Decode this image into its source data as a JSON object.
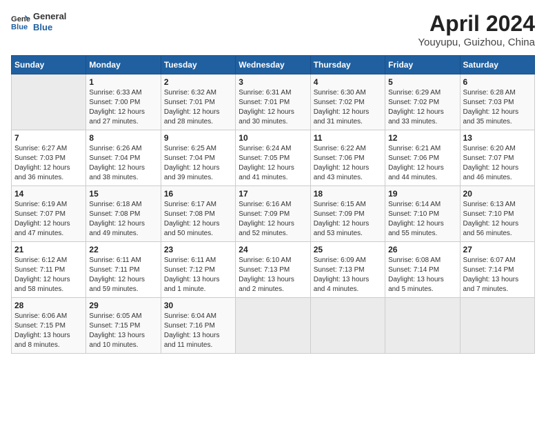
{
  "header": {
    "logo_line1": "General",
    "logo_line2": "Blue",
    "title": "April 2024",
    "subtitle": "Youyupu, Guizhou, China"
  },
  "days_of_week": [
    "Sunday",
    "Monday",
    "Tuesday",
    "Wednesday",
    "Thursday",
    "Friday",
    "Saturday"
  ],
  "weeks": [
    [
      {
        "day": "",
        "info": ""
      },
      {
        "day": "1",
        "info": "Sunrise: 6:33 AM\nSunset: 7:00 PM\nDaylight: 12 hours\nand 27 minutes."
      },
      {
        "day": "2",
        "info": "Sunrise: 6:32 AM\nSunset: 7:01 PM\nDaylight: 12 hours\nand 28 minutes."
      },
      {
        "day": "3",
        "info": "Sunrise: 6:31 AM\nSunset: 7:01 PM\nDaylight: 12 hours\nand 30 minutes."
      },
      {
        "day": "4",
        "info": "Sunrise: 6:30 AM\nSunset: 7:02 PM\nDaylight: 12 hours\nand 31 minutes."
      },
      {
        "day": "5",
        "info": "Sunrise: 6:29 AM\nSunset: 7:02 PM\nDaylight: 12 hours\nand 33 minutes."
      },
      {
        "day": "6",
        "info": "Sunrise: 6:28 AM\nSunset: 7:03 PM\nDaylight: 12 hours\nand 35 minutes."
      }
    ],
    [
      {
        "day": "7",
        "info": "Sunrise: 6:27 AM\nSunset: 7:03 PM\nDaylight: 12 hours\nand 36 minutes."
      },
      {
        "day": "8",
        "info": "Sunrise: 6:26 AM\nSunset: 7:04 PM\nDaylight: 12 hours\nand 38 minutes."
      },
      {
        "day": "9",
        "info": "Sunrise: 6:25 AM\nSunset: 7:04 PM\nDaylight: 12 hours\nand 39 minutes."
      },
      {
        "day": "10",
        "info": "Sunrise: 6:24 AM\nSunset: 7:05 PM\nDaylight: 12 hours\nand 41 minutes."
      },
      {
        "day": "11",
        "info": "Sunrise: 6:22 AM\nSunset: 7:06 PM\nDaylight: 12 hours\nand 43 minutes."
      },
      {
        "day": "12",
        "info": "Sunrise: 6:21 AM\nSunset: 7:06 PM\nDaylight: 12 hours\nand 44 minutes."
      },
      {
        "day": "13",
        "info": "Sunrise: 6:20 AM\nSunset: 7:07 PM\nDaylight: 12 hours\nand 46 minutes."
      }
    ],
    [
      {
        "day": "14",
        "info": "Sunrise: 6:19 AM\nSunset: 7:07 PM\nDaylight: 12 hours\nand 47 minutes."
      },
      {
        "day": "15",
        "info": "Sunrise: 6:18 AM\nSunset: 7:08 PM\nDaylight: 12 hours\nand 49 minutes."
      },
      {
        "day": "16",
        "info": "Sunrise: 6:17 AM\nSunset: 7:08 PM\nDaylight: 12 hours\nand 50 minutes."
      },
      {
        "day": "17",
        "info": "Sunrise: 6:16 AM\nSunset: 7:09 PM\nDaylight: 12 hours\nand 52 minutes."
      },
      {
        "day": "18",
        "info": "Sunrise: 6:15 AM\nSunset: 7:09 PM\nDaylight: 12 hours\nand 53 minutes."
      },
      {
        "day": "19",
        "info": "Sunrise: 6:14 AM\nSunset: 7:10 PM\nDaylight: 12 hours\nand 55 minutes."
      },
      {
        "day": "20",
        "info": "Sunrise: 6:13 AM\nSunset: 7:10 PM\nDaylight: 12 hours\nand 56 minutes."
      }
    ],
    [
      {
        "day": "21",
        "info": "Sunrise: 6:12 AM\nSunset: 7:11 PM\nDaylight: 12 hours\nand 58 minutes."
      },
      {
        "day": "22",
        "info": "Sunrise: 6:11 AM\nSunset: 7:11 PM\nDaylight: 12 hours\nand 59 minutes."
      },
      {
        "day": "23",
        "info": "Sunrise: 6:11 AM\nSunset: 7:12 PM\nDaylight: 13 hours\nand 1 minute."
      },
      {
        "day": "24",
        "info": "Sunrise: 6:10 AM\nSunset: 7:13 PM\nDaylight: 13 hours\nand 2 minutes."
      },
      {
        "day": "25",
        "info": "Sunrise: 6:09 AM\nSunset: 7:13 PM\nDaylight: 13 hours\nand 4 minutes."
      },
      {
        "day": "26",
        "info": "Sunrise: 6:08 AM\nSunset: 7:14 PM\nDaylight: 13 hours\nand 5 minutes."
      },
      {
        "day": "27",
        "info": "Sunrise: 6:07 AM\nSunset: 7:14 PM\nDaylight: 13 hours\nand 7 minutes."
      }
    ],
    [
      {
        "day": "28",
        "info": "Sunrise: 6:06 AM\nSunset: 7:15 PM\nDaylight: 13 hours\nand 8 minutes."
      },
      {
        "day": "29",
        "info": "Sunrise: 6:05 AM\nSunset: 7:15 PM\nDaylight: 13 hours\nand 10 minutes."
      },
      {
        "day": "30",
        "info": "Sunrise: 6:04 AM\nSunset: 7:16 PM\nDaylight: 13 hours\nand 11 minutes."
      },
      {
        "day": "",
        "info": ""
      },
      {
        "day": "",
        "info": ""
      },
      {
        "day": "",
        "info": ""
      },
      {
        "day": "",
        "info": ""
      }
    ]
  ]
}
